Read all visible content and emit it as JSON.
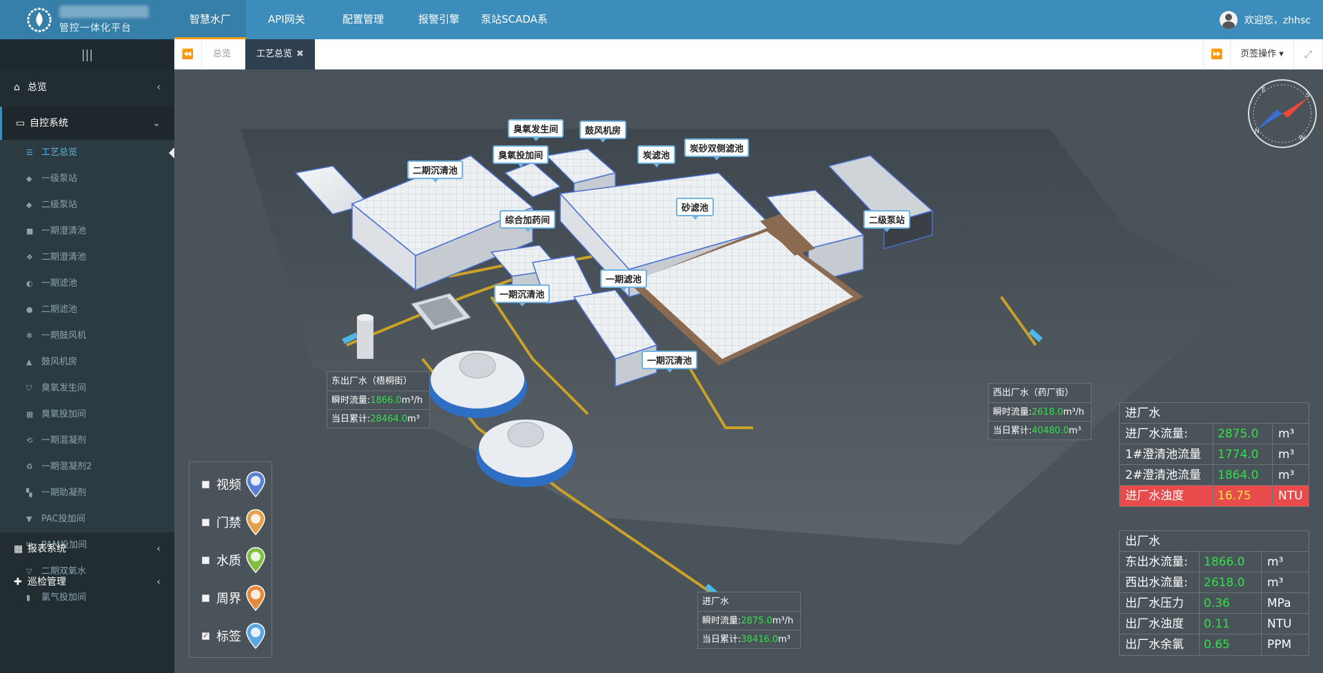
{
  "header": {
    "logo_subtitle": "管控一体化平台",
    "nav": [
      "智慧水厂",
      "API网关",
      "配置管理",
      "报警引擎",
      "泵站SCADA系"
    ],
    "welcome": "欢迎您，zhhsc"
  },
  "sidebar": {
    "collapse_icon": "|||",
    "overview": "总览",
    "zikong": "自控系统",
    "items": [
      "工艺总览",
      "一级泵站",
      "二级泵站",
      "一期澄清池",
      "二期澄清池",
      "一期滤池",
      "二期滤池",
      "一期鼓风机",
      "鼓风机房",
      "臭氧发生间",
      "臭氧投加间",
      "一期混凝剂",
      "一期混凝剂2",
      "一期助凝剂",
      "PAC投加间",
      "PAM投加间",
      "二期双氧水",
      "氯气投加间"
    ],
    "report": "报表系统",
    "patrol": "巡检管理"
  },
  "tabs": {
    "items": [
      "总览",
      "工艺总览"
    ],
    "page_ops": "页签操作",
    "close_glyph": "✖"
  },
  "scene_labels": [
    "臭氧发生间",
    "鼓风机房",
    "臭氧投加间",
    "二期沉清池",
    "炭滤池",
    "炭砂双侧滤池",
    "砂滤池",
    "综合加药间",
    "二级泵站",
    "一期滤池",
    "一期沉清池",
    "一期沉清池"
  ],
  "east_box": {
    "title": "东出厂水（梧桐街）",
    "flow_label": "瞬时流量:",
    "flow": "1866.0",
    "flow_unit": "m³/h",
    "total_label": "当日累计:",
    "total": "28464.0",
    "total_unit": "m³"
  },
  "west_box": {
    "title": "西出厂水（药厂街）",
    "flow_label": "瞬时流量:",
    "flow": "2618.0",
    "flow_unit": "m³/h",
    "total_label": "当日累计:",
    "total": "40480.0",
    "total_unit": "m³"
  },
  "inlet_box": {
    "title": "进厂水",
    "flow_label": "瞬时流量:",
    "flow": "2875.0",
    "flow_unit": "m³/h",
    "total_label": "当日累计:",
    "total": "38416.0",
    "total_unit": "m³"
  },
  "inflow_table": {
    "title": "进厂水",
    "rows": [
      {
        "label": "进厂水流量:",
        "value": "2875.0",
        "unit": "m³"
      },
      {
        "label": "1#澄清池流量",
        "value": "1774.0",
        "unit": "m³"
      },
      {
        "label": "2#澄清池流量",
        "value": "1864.0",
        "unit": "m³"
      },
      {
        "label": "进厂水浊度",
        "value": "16.75",
        "unit": "NTU"
      }
    ]
  },
  "outflow_table": {
    "title": "出厂水",
    "rows": [
      {
        "label": "东出水流量:",
        "value": "1866.0",
        "unit": "m³"
      },
      {
        "label": "西出水流量:",
        "value": "2618.0",
        "unit": "m³"
      },
      {
        "label": "出厂水压力",
        "value": "0.36",
        "unit": "MPa"
      },
      {
        "label": "出厂水浊度",
        "value": "0.11",
        "unit": "NTU"
      },
      {
        "label": "出厂水余氯",
        "value": "0.65",
        "unit": "PPM"
      }
    ]
  },
  "legend": [
    {
      "label": "视频",
      "checked": false,
      "color": "#5b7fd6"
    },
    {
      "label": "门禁",
      "checked": false,
      "color": "#e5a04c"
    },
    {
      "label": "水质",
      "checked": false,
      "color": "#7fbf3f"
    },
    {
      "label": "周界",
      "checked": false,
      "color": "#e58a3a"
    },
    {
      "label": "标签",
      "checked": true,
      "color": "#5aa7e0"
    }
  ],
  "compass_letters": [
    "E",
    "S",
    "N",
    "W"
  ],
  "colors": {
    "accent": "#3c8dbc",
    "sidebar": "#222d32",
    "value_green": "#33e04a",
    "alarm_red": "#e84b4b"
  }
}
